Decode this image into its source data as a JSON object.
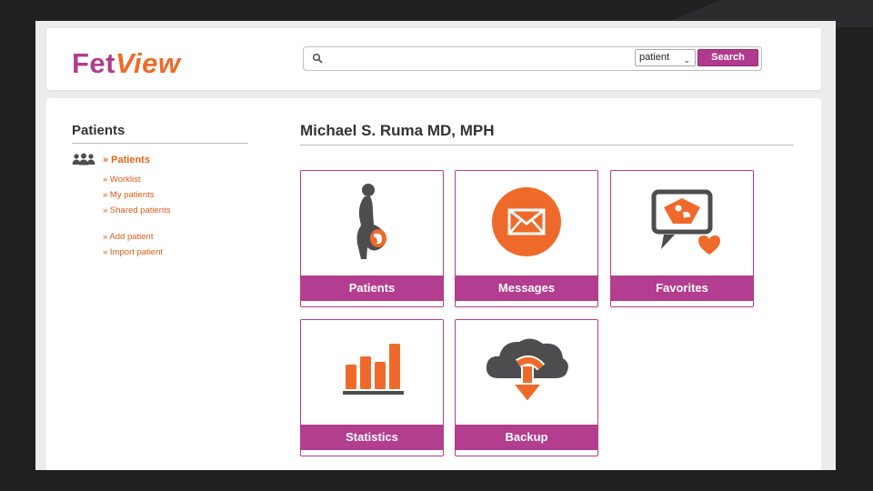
{
  "app": {
    "logo_part1": "Fet",
    "logo_part2": "View"
  },
  "search": {
    "placeholder": "",
    "value": "",
    "scope_selected": "patient",
    "button_label": "Search"
  },
  "sidebar": {
    "title": "Patients",
    "main_link": "» Patients",
    "links": [
      "» Worklist",
      "» My patients",
      "» Shared patients",
      "» Add patient",
      "» Import patient"
    ]
  },
  "main": {
    "user_name": "Michael S. Ruma MD, MPH",
    "tiles": [
      {
        "label": "Patients",
        "icon": "pregnant-woman-icon"
      },
      {
        "label": "Messages",
        "icon": "envelope-icon"
      },
      {
        "label": "Favorites",
        "icon": "ultrasound-heart-icon"
      },
      {
        "label": "Statistics",
        "icon": "bar-chart-icon"
      },
      {
        "label": "Backup",
        "icon": "cloud-download-icon"
      }
    ]
  },
  "colors": {
    "brand_purple": "#b33d8e",
    "brand_orange": "#ef6a2a",
    "icon_gray": "#4d4d4f"
  }
}
